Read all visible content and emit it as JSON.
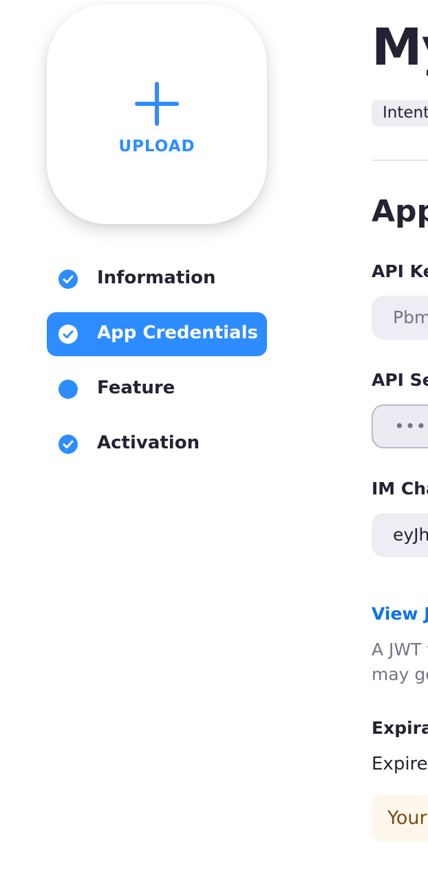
{
  "upload": {
    "label": "UPLOAD",
    "icon": "plus-icon"
  },
  "colors": {
    "accent": "#2d8cff",
    "link": "#0e72ed",
    "text": "#232333",
    "muted": "#747487"
  },
  "nav": {
    "items": [
      {
        "label": "Information",
        "icon": "check-circle-icon",
        "state": "done"
      },
      {
        "label": "App Credentials",
        "icon": "check-circle-icon",
        "state": "active"
      },
      {
        "label": "Feature",
        "icon": "dot-circle-icon",
        "state": "incomplete"
      },
      {
        "label": "Activation",
        "icon": "check-circle-icon",
        "state": "done"
      }
    ]
  },
  "header": {
    "title": "My",
    "tag": "Intent"
  },
  "section": {
    "title": "App",
    "api_key": {
      "label": "API Key",
      "value": "Pbm"
    },
    "api_secret": {
      "label": "API Sec",
      "value": "••••••"
    },
    "im_chat": {
      "label": "IM Cha",
      "value": "eyJh"
    },
    "jwt_link": "View JW",
    "jwt_desc_line1": "A JWT t",
    "jwt_desc_line2": "may go",
    "expiration": {
      "label": "Expirat",
      "value": "Expire"
    },
    "warning": "Your"
  }
}
